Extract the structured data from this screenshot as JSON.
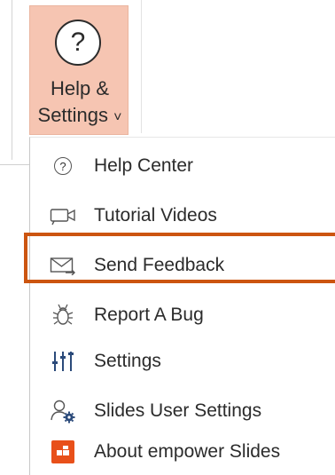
{
  "ribbon": {
    "help_button": {
      "icon": "question-mark-icon",
      "icon_glyph": "?",
      "line1": "Help &",
      "line2": "Settings",
      "chevron": "˅"
    }
  },
  "menu": {
    "items": [
      {
        "label": "Help Center",
        "icon": "question-circle-icon"
      },
      {
        "label": "Tutorial Videos",
        "icon": "video-camera-icon"
      },
      {
        "label": "Send Feedback",
        "icon": "envelope-arrow-icon",
        "highlighted": true
      },
      {
        "label": "Report A Bug",
        "icon": "bug-icon"
      },
      {
        "label": "Settings",
        "icon": "sliders-icon"
      },
      {
        "label": "Slides User Settings",
        "icon": "user-gear-icon"
      },
      {
        "label": "About empower Slides",
        "icon": "empower-logo-icon"
      }
    ]
  },
  "colors": {
    "button_bg": "#f6c5b2",
    "highlight_border": "#cc5510",
    "logo": "#e8501a"
  }
}
